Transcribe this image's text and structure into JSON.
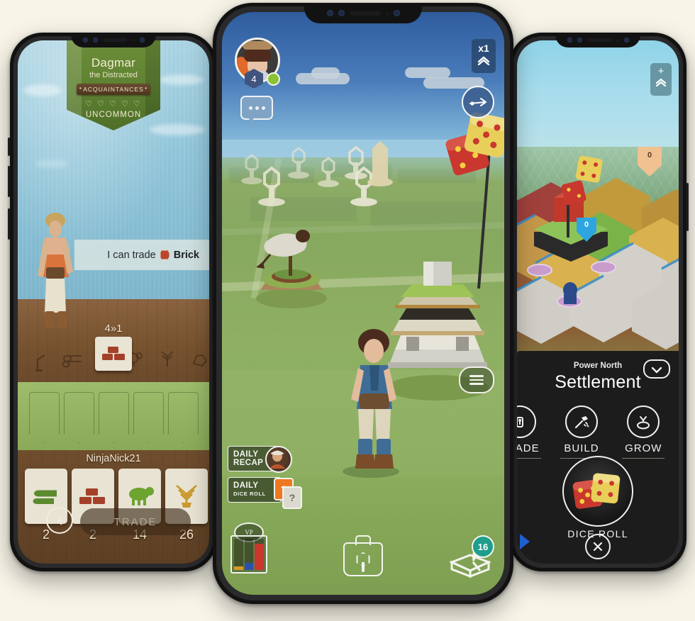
{
  "scene": {
    "background_color": "#f8f5e8",
    "device_count": 3,
    "description": "Three smartphones showing a hexagon strategy board game"
  },
  "left_phone": {
    "name": "left-phone",
    "banner": {
      "character_name": "Dagmar",
      "character_epithet": "the Distracted",
      "relationship": "ACQUAINTANCES",
      "hearts": "♡ ♡ ♡ ♡ ♡",
      "heart_count": 5,
      "rarity": "UNCOMMON"
    },
    "dialog": {
      "prefix": "I can trade",
      "resource": "Brick",
      "resource_icon": "brick-hex-icon",
      "resource_color": "#b8472e"
    },
    "offer": {
      "ratio": "4»1",
      "card_resource": "brick"
    },
    "table_resource_icons": [
      "lumber-icon",
      "brick-icon",
      "wool-icon",
      "grain-icon",
      "ore-icon"
    ],
    "player": {
      "name": "NinjaNick21"
    },
    "hand": [
      {
        "resource": "lumber",
        "icon": "lumber-icon",
        "count": "2",
        "color": "#5c8a2e"
      },
      {
        "resource": "brick",
        "icon": "brick-icon",
        "count": "2",
        "color": "#a4402a"
      },
      {
        "resource": "wool",
        "icon": "wool-icon",
        "count": "14",
        "color": "#6da32f"
      },
      {
        "resource": "grain",
        "icon": "grain-icon",
        "count": "26",
        "color": "#c99a2e"
      }
    ],
    "buttons": {
      "back": "back-arrow-icon",
      "trade": "TRADE"
    }
  },
  "center_phone": {
    "name": "center-phone",
    "player_badge": {
      "level": "4",
      "status": "online",
      "status_color": "#8bc334"
    },
    "chat_icon": "chat-bubble-icon",
    "speed_button": {
      "label": "x1",
      "icon": "chevron-up-icon"
    },
    "compass_button": "compass-arrow-icon",
    "menu_button": "hamburger-menu-icon",
    "daily_recap": {
      "line1": "DAILY",
      "line2": "RECAP",
      "thumb": "character-portrait-icon"
    },
    "daily_dice": {
      "line1": "DAILY",
      "line2": "DICE ROLL",
      "icon_front": "?",
      "icon_back": "?",
      "front_color": "#ef7722",
      "back_color": "#dcdad0"
    },
    "victory_points": {
      "label": "VP",
      "columns": [
        {
          "color": "#d69a2d",
          "fill": "12%"
        },
        {
          "color": "#2b52a8",
          "fill": "22%"
        },
        {
          "color": "#c9372e",
          "fill": "84%"
        }
      ]
    },
    "backpack_button": "backpack-icon",
    "quests": {
      "icon": "quill-book-icon",
      "count": "16",
      "badge_color": "#1f9e8c"
    }
  },
  "right_phone": {
    "name": "right-phone",
    "zoom_button": {
      "plus": "+",
      "icon": "chevron-up-icon"
    },
    "map_markers": [
      {
        "value": "0",
        "type": "gold-marker",
        "color": "#f0c191"
      },
      {
        "value": "0",
        "type": "blue-shield",
        "color": "#2ea5e0"
      }
    ],
    "panel": {
      "subtitle": "Power North",
      "title": "Settlement",
      "collapse_icon": "chevron-down-icon",
      "actions": [
        {
          "label": "TRADE",
          "icon": "trade-icon",
          "clipped": true
        },
        {
          "label": "BUILD",
          "icon": "hammer-icon",
          "clipped": false
        },
        {
          "label": "GROW",
          "icon": "grow-icon",
          "clipped": false
        }
      ],
      "dice": {
        "label": "DICE ROLL",
        "icon": "two-dice-icon",
        "die1_color": "#c9372e",
        "die2_color": "#e8cf5a"
      },
      "close_icon": "close-x-icon"
    }
  }
}
